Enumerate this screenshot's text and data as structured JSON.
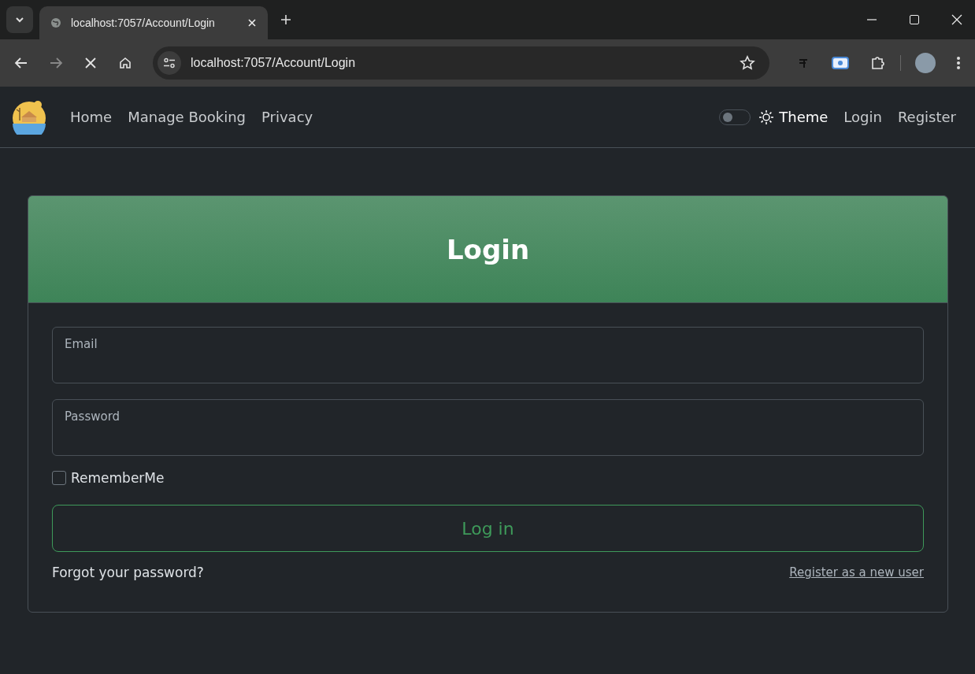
{
  "browser": {
    "tab_title": "localhost:7057/Account/Login",
    "address": "localhost:7057/Account/Login"
  },
  "navbar": {
    "links": [
      {
        "label": "Home"
      },
      {
        "label": "Manage Booking"
      },
      {
        "label": "Privacy"
      }
    ],
    "theme_toggle": {
      "on": false,
      "label": "Theme"
    },
    "auth_links": [
      {
        "label": "Login"
      },
      {
        "label": "Register"
      }
    ]
  },
  "card": {
    "title": "Login",
    "fields": [
      {
        "placeholder": "Email"
      },
      {
        "placeholder": "Password"
      }
    ],
    "remember_me": {
      "label": "RememberMe",
      "checked": false
    },
    "submit_button": "Log in",
    "forgot_link": "Forgot your password?",
    "register_link": "Register as a new user"
  }
}
